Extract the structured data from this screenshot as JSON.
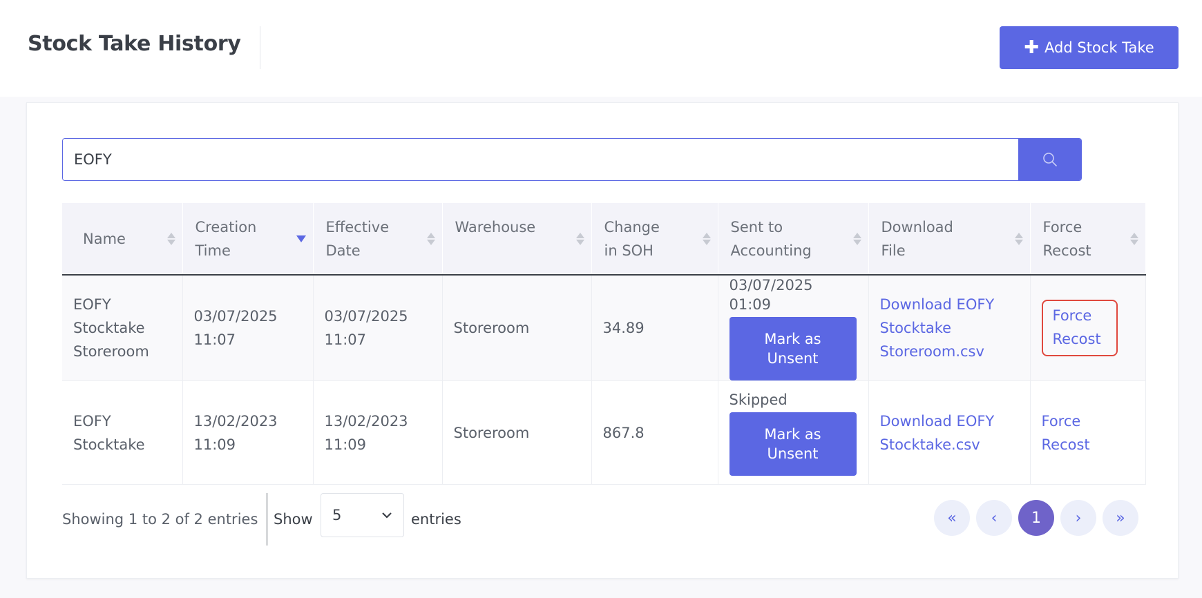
{
  "header": {
    "title": "Stock Take History",
    "add_button_label": "Add Stock Take"
  },
  "search": {
    "value": "EOFY",
    "placeholder": ""
  },
  "table": {
    "columns": [
      {
        "line1": "Name",
        "line2": ""
      },
      {
        "line1": "Creation",
        "line2": "Time"
      },
      {
        "line1": "Effective",
        "line2": "Date"
      },
      {
        "line1": "Warehouse",
        "line2": ""
      },
      {
        "line1": "Change",
        "line2": "in SOH"
      },
      {
        "line1": "Sent to",
        "line2": "Accounting"
      },
      {
        "line1": "Download",
        "line2": "File"
      },
      {
        "line1": "Force",
        "line2": "Recost"
      }
    ],
    "sorted_column": "Creation Time",
    "sort_direction": "descending",
    "rows": [
      {
        "name": [
          "EOFY",
          "Stocktake",
          "Storeroom"
        ],
        "creation_time": [
          "03/07/2025",
          "11:07"
        ],
        "effective_date": [
          "03/07/2025",
          "11:07"
        ],
        "warehouse": "Storeroom",
        "change_in_soh": "34.89",
        "sent_status": "03/07/2025 01:09",
        "mark_unsent_label": [
          "Mark as",
          "Unsent"
        ],
        "download": [
          "Download EOFY",
          "Stocktake",
          "Storeroom.csv"
        ],
        "force_recost": [
          "Force",
          "Recost"
        ]
      },
      {
        "name": [
          "EOFY",
          "Stocktake"
        ],
        "creation_time": [
          "13/02/2023",
          "11:09"
        ],
        "effective_date": [
          "13/02/2023",
          "11:09"
        ],
        "warehouse": "Storeroom",
        "change_in_soh": "867.8",
        "sent_status": "Skipped",
        "mark_unsent_label": [
          "Mark as",
          "Unsent"
        ],
        "download": [
          "Download EOFY",
          "Stocktake.csv"
        ],
        "force_recost": [
          "Force",
          "Recost"
        ]
      }
    ]
  },
  "footer": {
    "showing_text": "Showing 1 to 2 of 2 entries",
    "show_label": "Show",
    "page_size": "5",
    "entries_label": "entries",
    "pagination": {
      "first": "«",
      "prev": "‹",
      "current": "1",
      "next": "›",
      "last": "»"
    }
  },
  "colors": {
    "accent": "#5b67e3",
    "active_page": "#6f63c9",
    "highlight_border": "#e0483e"
  },
  "icons": {
    "add": "plus-icon",
    "search": "search-icon",
    "sort": "sort-icon",
    "dropdown": "chevron-down-icon"
  }
}
